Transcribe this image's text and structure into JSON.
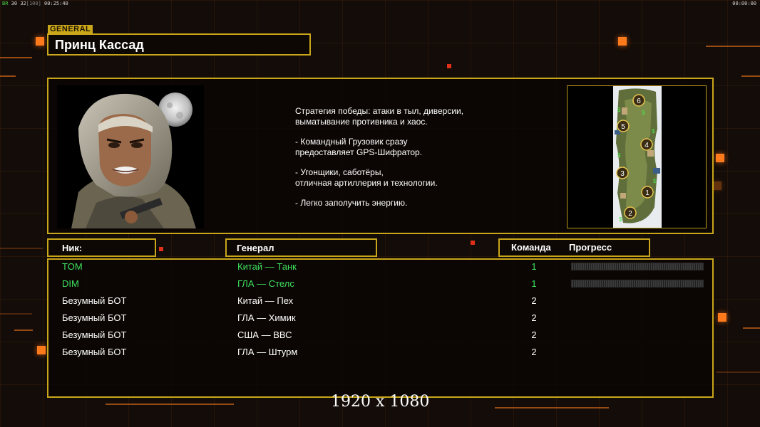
{
  "hud": {
    "left_prefix": "BR",
    "left_fps": "30",
    "left_mid": "32",
    "left_bracket": "[100]",
    "left_time": "00:25:40",
    "right_time": "00:00:00"
  },
  "general": {
    "tag": "GENERAL",
    "name": "Принц Кассад"
  },
  "strategy": [
    "Стратегия победы: атаки в тыл, диверсии,\n выматывание противника и хаос.",
    "- Командный Грузовик сразу\nпредоставляет GPS-Шифратор.",
    "- Угонщики, саботёры,\nотличная артиллерия и технологии.",
    "- Легко заполучить энергию."
  ],
  "minimap": {
    "start_positions": [
      "1",
      "2",
      "3",
      "4",
      "5",
      "6"
    ]
  },
  "table": {
    "headers": {
      "nick": "Ник:",
      "general": "Генерал",
      "team": "Команда",
      "progress": "Прогресс"
    },
    "rows": [
      {
        "nick": "TOM",
        "general": "Китай — Танк",
        "team": "1",
        "human": true
      },
      {
        "nick": "DIM",
        "general": "ГЛА — Стелс",
        "team": "1",
        "human": true
      },
      {
        "nick": "Безумный БОТ",
        "general": "Китай — Пех",
        "team": "2",
        "human": false
      },
      {
        "nick": "Безумный БОТ",
        "general": "ГЛА — Химик",
        "team": "2",
        "human": false
      },
      {
        "nick": "Безумный БОТ",
        "general": "США — ВВС",
        "team": "2",
        "human": false
      },
      {
        "nick": "Безумный БОТ",
        "general": "ГЛА — Штурм",
        "team": "2",
        "human": false
      }
    ]
  },
  "resolution_label": "1920 x 1080",
  "colors": {
    "frame": "#c9a61a",
    "human_player": "#3de05c",
    "accent": "#ff7a1a"
  }
}
